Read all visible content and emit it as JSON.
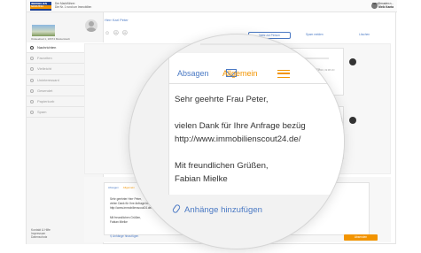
{
  "brand": {
    "line1": "IMMOBILIEN",
    "line2": "SCOUT24"
  },
  "tagline": [
    "Der Marktführer:",
    "Die Nr. 1 rund um Immobilien"
  ],
  "user": {
    "line1": "max@muster.n...",
    "name": "Meik Kanta"
  },
  "listing": {
    "caption": "Ostseebad 1, 18374 Musterstadt"
  },
  "nav": [
    {
      "label": "Nachrichten",
      "count": "7",
      "active": true
    },
    {
      "label": "Favoriten",
      "count": "5"
    },
    {
      "label": "Vielleicht",
      "count": "8"
    },
    {
      "label": "Uninteressant",
      "count": "11"
    },
    {
      "label": "Gesendet",
      "count": "14"
    },
    {
      "label": "Papierkorb",
      "count": "34"
    },
    {
      "label": "Spam",
      "count": "88"
    }
  ],
  "footer_links": [
    "Kontakt & Hilfe",
    "Impressum",
    "Datenschutz"
  ],
  "thread": {
    "sender": "Herr Karl Peter",
    "emoji": "☺ ☹ ☹",
    "note_button": "Notiz zur Person",
    "spam_link": "Spam melden",
    "delete_link": "Löschen",
    "snippet": "Anton Kol",
    "timestamp": "18.11.2016, 19:38 Uhr"
  },
  "compose": {
    "tab_reject": "Absagen",
    "tab_general": "Allgemein",
    "greeting": "Sehr geehrter Herr Peter,",
    "body": "vielen Dank für Ihre Anfrage bezüglich\nhttp://www.immobilienscout24.de/expose\n\nMit freundlichen Grüßen,\nFabian Mielke",
    "attach": "Anhänge hinzufügen",
    "send": "Absenden"
  },
  "lens": {
    "tab_reject": "Absagen",
    "tab_general": "Allgemein",
    "greeting": "Sehr geehrte Frau Peter,",
    "body": "vielen Dank für Ihre Anfrage bezüg\nhttp://www.immobilienscout24.de/\n\nMit freundlichen Grüßen,\nFabian Mielke",
    "attach": "Anhänge hinzufügen"
  }
}
